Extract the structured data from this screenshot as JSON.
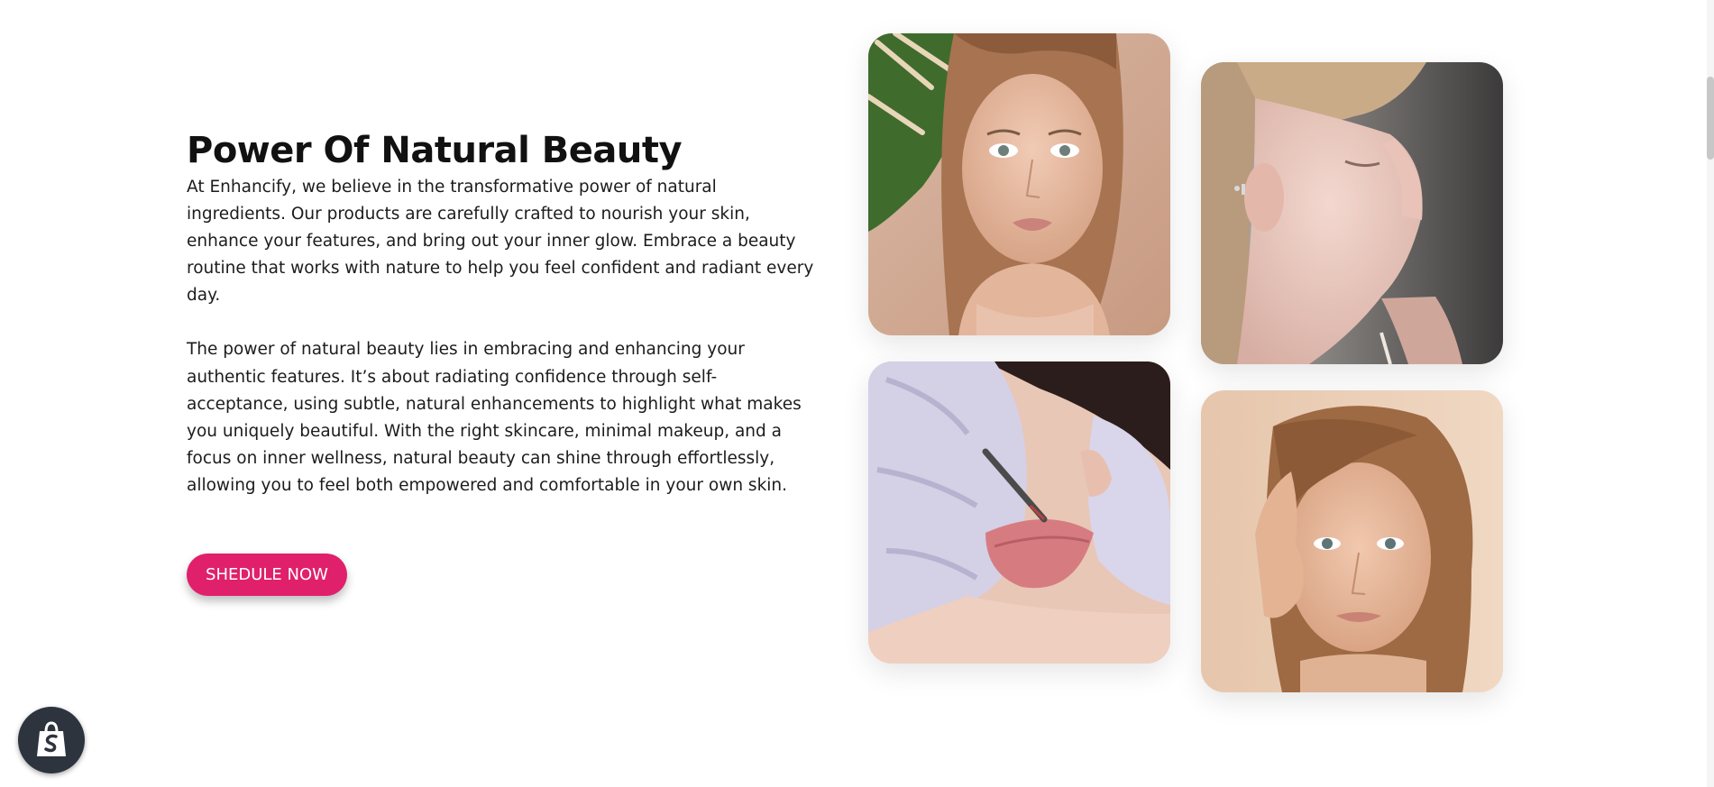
{
  "section": {
    "title": "Power Of Natural Beauty",
    "paragraphs": [
      "At Enhancify, we believe in the transformative power of natural ingredients. Our products are carefully crafted to nourish your skin, enhance your features, and bring out your inner glow. Embrace a beauty routine that works with nature to help you feel confident and radiant every day.",
      "The power of natural beauty lies in embracing and enhancing your authentic features. It’s about radiating confidence through self-acceptance, using subtle, natural enhancements to highlight what makes you uniquely beautiful. With the right skincare, minimal makeup, and a focus on inner wellness, natural beauty can shine through effortlessly, allowing you to feel both empowered and comfortable in your own skin."
    ],
    "cta_label": "SHEDULE NOW"
  },
  "gallery": {
    "images": [
      {
        "icon": "woman-portrait-with-leaf"
      },
      {
        "icon": "woman-profile-eyes-closed"
      },
      {
        "icon": "lip-tattoo-procedure"
      },
      {
        "icon": "woman-hand-on-face"
      }
    ]
  },
  "shopify_badge": {
    "icon": "shopify-bag-icon"
  },
  "colors": {
    "accent": "#e0206b",
    "text": "#1c1c1c",
    "badge": "#2d343e"
  }
}
